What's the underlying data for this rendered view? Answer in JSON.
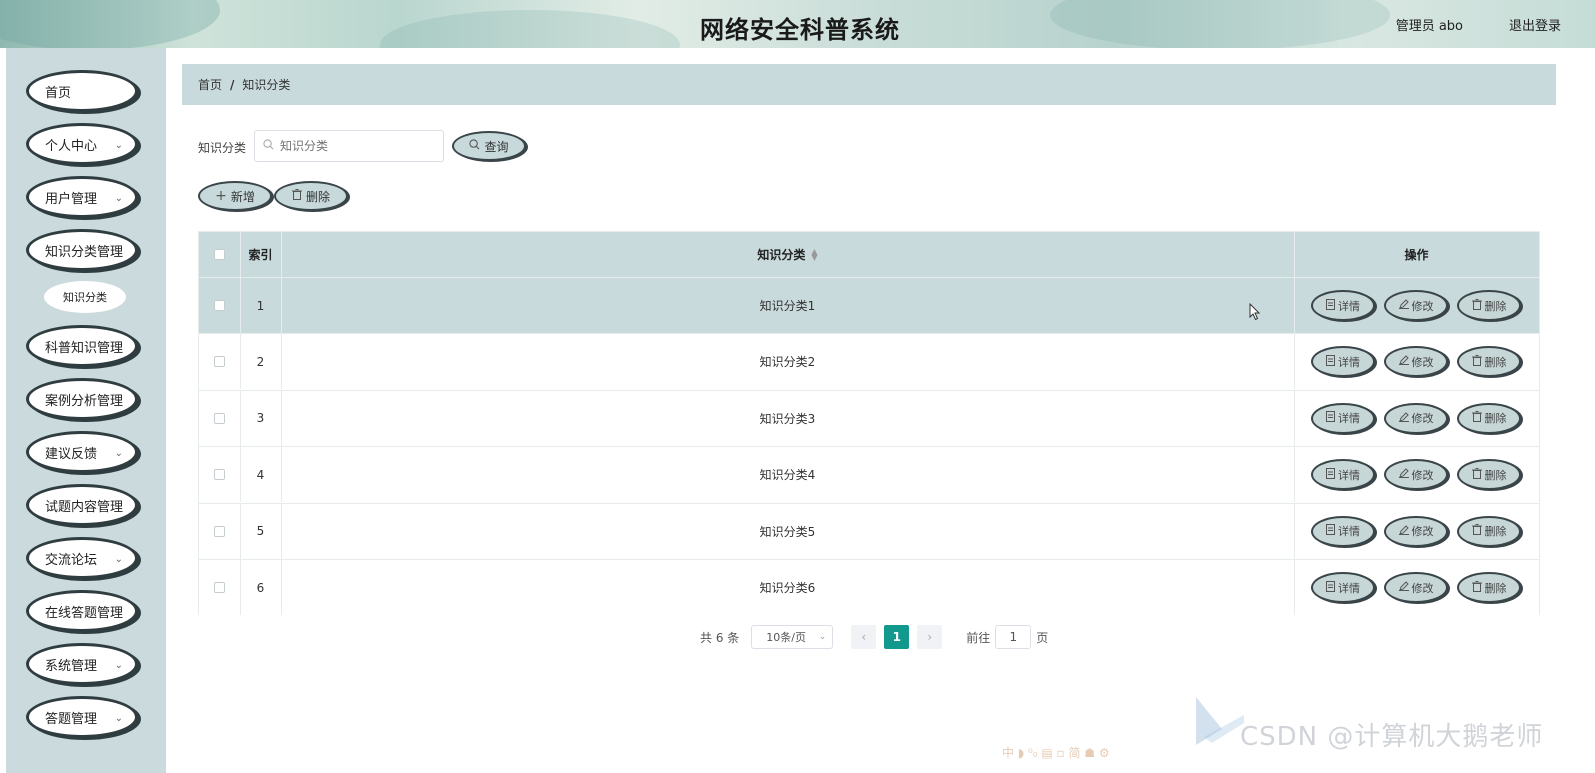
{
  "header": {
    "title": "网络安全科普系统",
    "user": "管理员 abo",
    "logout": "退出登录"
  },
  "sidebar": {
    "items": [
      {
        "label": "首页",
        "has_arrow": false
      },
      {
        "label": "个人中心",
        "has_arrow": true
      },
      {
        "label": "用户管理",
        "has_arrow": true
      },
      {
        "label": "知识分类管理",
        "has_arrow": false
      },
      {
        "label": "科普知识管理",
        "has_arrow": false
      },
      {
        "label": "案例分析管理",
        "has_arrow": false
      },
      {
        "label": "建议反馈",
        "has_arrow": true
      },
      {
        "label": "试题内容管理",
        "has_arrow": false
      },
      {
        "label": "交流论坛",
        "has_arrow": true
      },
      {
        "label": "在线答题管理",
        "has_arrow": false
      },
      {
        "label": "系统管理",
        "has_arrow": true
      },
      {
        "label": "答题管理",
        "has_arrow": true
      }
    ],
    "submenu": {
      "label": "知识分类"
    }
  },
  "breadcrumb": {
    "home": "首页",
    "current": "知识分类"
  },
  "search": {
    "label": "知识分类",
    "placeholder": "知识分类",
    "query_button": "查询"
  },
  "toolbar": {
    "add_label": "新增",
    "delete_label": "删除"
  },
  "table": {
    "headers": {
      "index": "索引",
      "category": "知识分类",
      "actions": "操作"
    },
    "rows": [
      {
        "index": "1",
        "category": "知识分类1"
      },
      {
        "index": "2",
        "category": "知识分类2"
      },
      {
        "index": "3",
        "category": "知识分类3"
      },
      {
        "index": "4",
        "category": "知识分类4"
      },
      {
        "index": "5",
        "category": "知识分类5"
      },
      {
        "index": "6",
        "category": "知识分类6"
      }
    ],
    "row_actions": {
      "detail": "详情",
      "edit": "修改",
      "delete": "删除"
    }
  },
  "pagination": {
    "total": "共 6 条",
    "page_size": "10条/页",
    "current_page": "1",
    "goto_label": "前往",
    "goto_value": "1",
    "page_suffix": "页"
  },
  "watermark": "CSDN @计算机大鹅老师",
  "ime_bar": "中 ◗ ⁰₀ ▤ ▫ 简 ☗ ⚙",
  "colors": {
    "accent": "#11998e",
    "sidebar_bg": "#cbdadc",
    "header_row_bg": "#c9dadc"
  }
}
